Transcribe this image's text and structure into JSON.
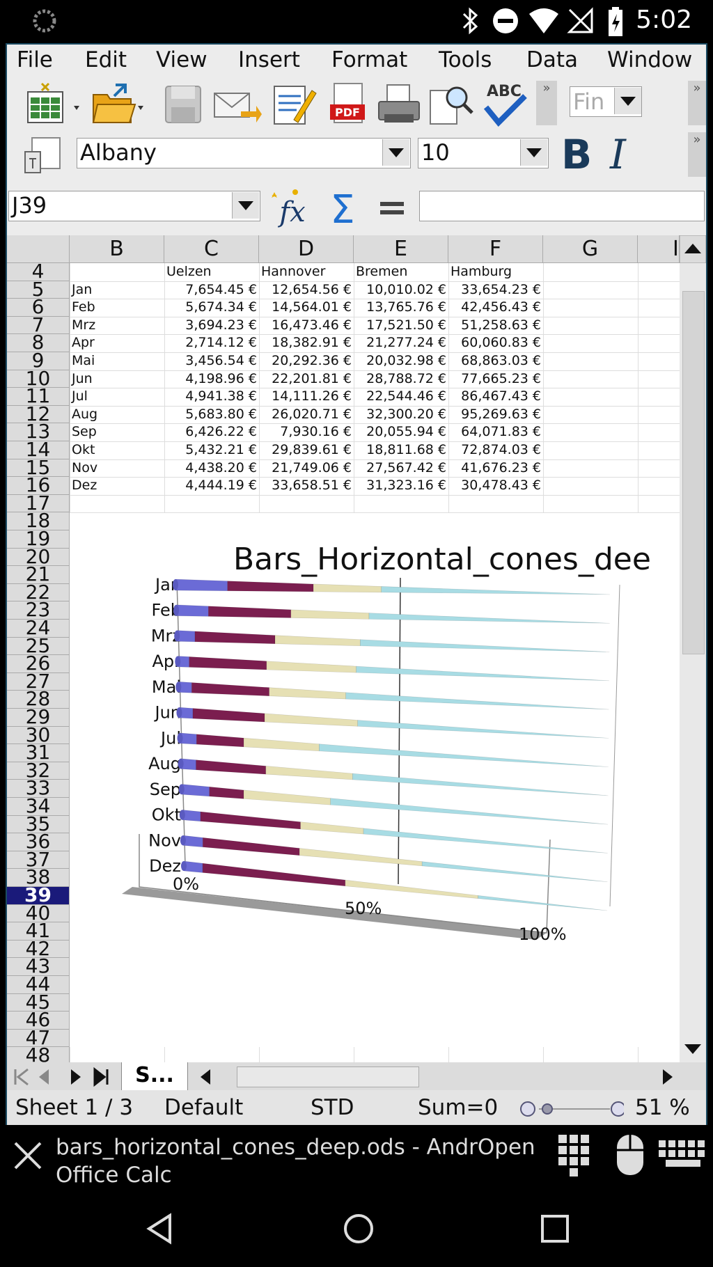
{
  "status_bar": {
    "time": "5:02"
  },
  "menu": [
    "File",
    "Edit",
    "View",
    "Insert",
    "Format",
    "Tools",
    "Data",
    "Window"
  ],
  "toolbar": {
    "style_box": "Fin"
  },
  "formatting": {
    "font_name": "Albany",
    "font_size": "10"
  },
  "formula_bar": {
    "cell_ref": "J39",
    "formula": ""
  },
  "columns": [
    "B",
    "C",
    "D",
    "E",
    "F",
    "G",
    "I"
  ],
  "rows": [
    "4",
    "5",
    "6",
    "7",
    "8",
    "9",
    "10",
    "11",
    "12",
    "13",
    "14",
    "15",
    "16",
    "17",
    "18",
    "19",
    "20",
    "21",
    "22",
    "23",
    "24",
    "25",
    "26",
    "27",
    "28",
    "29",
    "30",
    "31",
    "32",
    "33",
    "34",
    "35",
    "36",
    "37",
    "38",
    "39",
    "40",
    "41",
    "42",
    "43",
    "44",
    "45",
    "46",
    "47",
    "48"
  ],
  "selected_row": "39",
  "table": {
    "headers": [
      "Uelzen",
      "Hannover",
      "Bremen",
      "Hamburg"
    ],
    "rows": [
      {
        "month": "Jan",
        "values": [
          "7,654.45 €",
          "12,654.56 €",
          "10,010.02 €",
          "33,654.23 €"
        ]
      },
      {
        "month": "Feb",
        "values": [
          "5,674.34 €",
          "14,564.01 €",
          "13,765.76 €",
          "42,456.43 €"
        ]
      },
      {
        "month": "Mrz",
        "values": [
          "3,694.23 €",
          "16,473.46 €",
          "17,521.50 €",
          "51,258.63 €"
        ]
      },
      {
        "month": "Apr",
        "values": [
          "2,714.12 €",
          "18,382.91 €",
          "21,277.24 €",
          "60,060.83 €"
        ]
      },
      {
        "month": "Mai",
        "values": [
          "3,456.54 €",
          "20,292.36 €",
          "20,032.98 €",
          "68,863.03 €"
        ]
      },
      {
        "month": "Jun",
        "values": [
          "4,198.96 €",
          "22,201.81 €",
          "28,788.72 €",
          "77,665.23 €"
        ]
      },
      {
        "month": "Jul",
        "values": [
          "4,941.38 €",
          "14,111.26 €",
          "22,544.46 €",
          "86,467.43 €"
        ]
      },
      {
        "month": "Aug",
        "values": [
          "5,683.80 €",
          "26,020.71 €",
          "32,300.20 €",
          "95,269.63 €"
        ]
      },
      {
        "month": "Sep",
        "values": [
          "6,426.22 €",
          "7,930.16 €",
          "20,055.94 €",
          "64,071.83 €"
        ]
      },
      {
        "month": "Okt",
        "values": [
          "5,432.21 €",
          "29,839.61 €",
          "18,811.68 €",
          "72,874.03 €"
        ]
      },
      {
        "month": "Nov",
        "values": [
          "4,438.20 €",
          "21,749.06 €",
          "27,567.42 €",
          "41,676.23 €"
        ]
      },
      {
        "month": "Dez",
        "values": [
          "4,444.19 €",
          "33,658.51 €",
          "31,323.16 €",
          "30,478.43 €"
        ]
      }
    ]
  },
  "chart_data": {
    "type": "bar",
    "orientation": "horizontal",
    "stacked": "percent",
    "shape": "cone",
    "title": "Bars_Horizontal_cones_dee",
    "categories": [
      "Jan",
      "Feb",
      "Mrz",
      "Apr",
      "Mai",
      "Jun",
      "Jul",
      "Aug",
      "Sep",
      "Okt",
      "Nov",
      "Dez"
    ],
    "series": [
      {
        "color": "#6b6bd6",
        "values": [
          7654.45,
          5674.34,
          3694.23,
          2714.12,
          3456.54,
          4198.96,
          4941.38,
          5683.8,
          6426.22,
          5432.21,
          4438.2,
          4444.19
        ]
      },
      {
        "color": "#7b1e4f",
        "values": [
          12654.56,
          14564.01,
          16473.46,
          18382.91,
          20292.36,
          22201.81,
          14111.26,
          26020.71,
          7930.16,
          29839.61,
          21749.06,
          33658.51
        ]
      },
      {
        "color": "#e6e0b4",
        "values": [
          10010.02,
          13765.76,
          17521.5,
          21277.24,
          20032.98,
          28788.72,
          22544.46,
          32300.2,
          20055.94,
          18811.68,
          27567.42,
          31323.16
        ]
      },
      {
        "color": "#a8dce4",
        "values": [
          33654.23,
          42456.43,
          51258.63,
          60060.83,
          68863.03,
          77665.23,
          86467.43,
          95269.63,
          64071.83,
          72874.03,
          41676.23,
          30478.43
        ]
      }
    ],
    "x_ticks": [
      "0%",
      "50%",
      "100%"
    ],
    "xlim": [
      0,
      100
    ]
  },
  "sheet_tab": "S...",
  "statusbar": {
    "sheet": "Sheet 1 / 3",
    "style": "Default",
    "mode": "STD",
    "sum": "Sum=0",
    "zoom": "51 %"
  },
  "notification": {
    "title": "bars_horizontal_cones_deep.ods - AndrOpen Office Calc"
  }
}
